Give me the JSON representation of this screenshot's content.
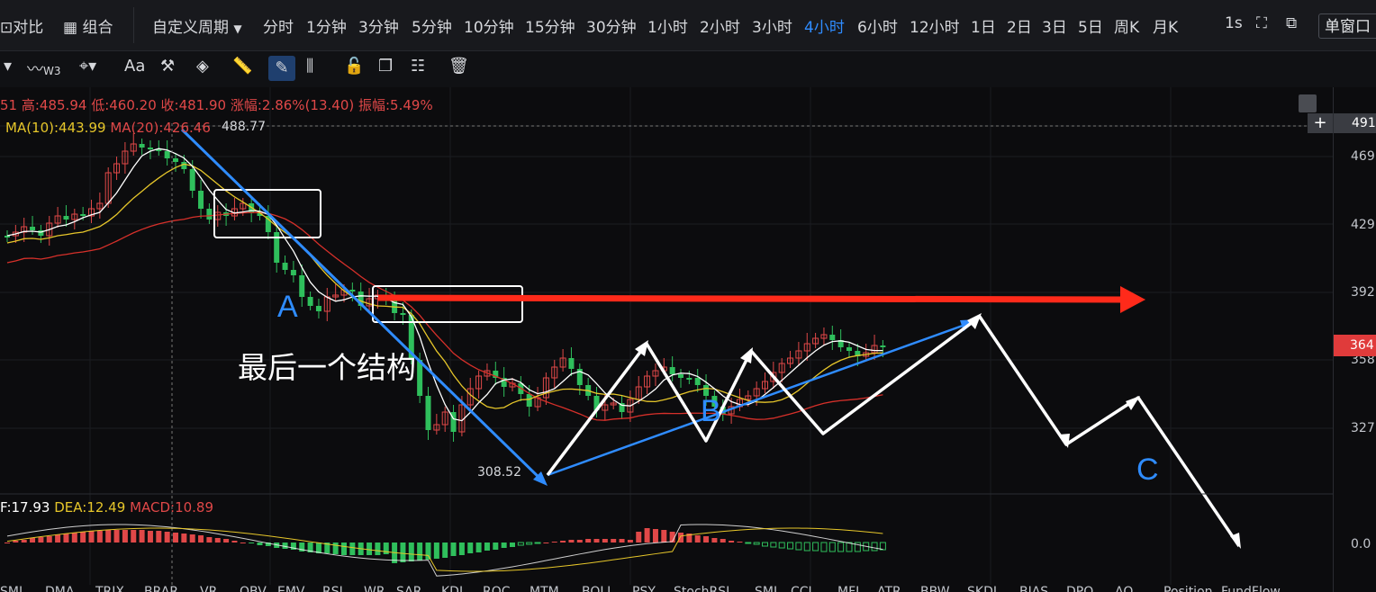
{
  "topbar": {
    "compare_label": "对比",
    "combine_label": "组合",
    "custom_period_label": "自定义周期",
    "periods": [
      "分时",
      "1分钟",
      "3分钟",
      "5分钟",
      "10分钟",
      "15分钟",
      "30分钟",
      "1小时",
      "2小时",
      "3小时",
      "4小时",
      "6小时",
      "12小时",
      "1日",
      "2日",
      "3日",
      "5日",
      "周K",
      "月K"
    ],
    "active_period": "4小时",
    "interval_label": "1s",
    "single_window_label": "单窗口"
  },
  "toolbar": {
    "text_tool_label": "Aa",
    "indicator_label": "W3"
  },
  "ohlc": {
    "open_fragment": "51",
    "high_label": "高:485.94",
    "low_label": "低:460.20",
    "close_label": "收:481.90",
    "change_label": "涨幅:2.86%(13.40)",
    "amplitude_label": "振幅:5.49%"
  },
  "ma": {
    "ma10_label": "MA(10):443.99",
    "ma20_label": "MA(20):426.46",
    "peak_label": "488.77"
  },
  "annotations": {
    "label_a": "A",
    "label_b": "B",
    "label_c": "C",
    "structure_text": "最后一个结构",
    "low_label": "308.52"
  },
  "macd": {
    "dif_label": "F:17.93",
    "dea_label": "DEA:12.49",
    "macd_label": "MACD:10.89"
  },
  "y_axis": {
    "labels": [
      "491",
      "469",
      "429",
      "392",
      "358",
      "327",
      "0.0"
    ],
    "current_price": "364",
    "plus_symbol": "+"
  },
  "indicator_tabs": [
    "SMI",
    "DMA",
    "TRIX",
    "BRAR",
    "VR",
    "OBV",
    "EMV",
    "RSI",
    "WR",
    "SAR",
    "KDJ",
    "ROC",
    "MTM",
    "BOLL",
    "PSY",
    "StochRSI",
    "SMI",
    "CCI",
    "MFI",
    "ATR",
    "BBW",
    "SKDJ",
    "BIAS",
    "DPO",
    "AO",
    "Position",
    "FundFlow"
  ],
  "colors": {
    "bg": "#0c0c0e",
    "up": "#e04848",
    "down": "#2fbf5c",
    "blue_arrow": "#2f8cff",
    "red_arrow": "#ff2a1a",
    "ma10": "#ffffff",
    "ma20": "#e6c62a",
    "ma60": "#d6302a",
    "active": "#2f8cff"
  }
}
